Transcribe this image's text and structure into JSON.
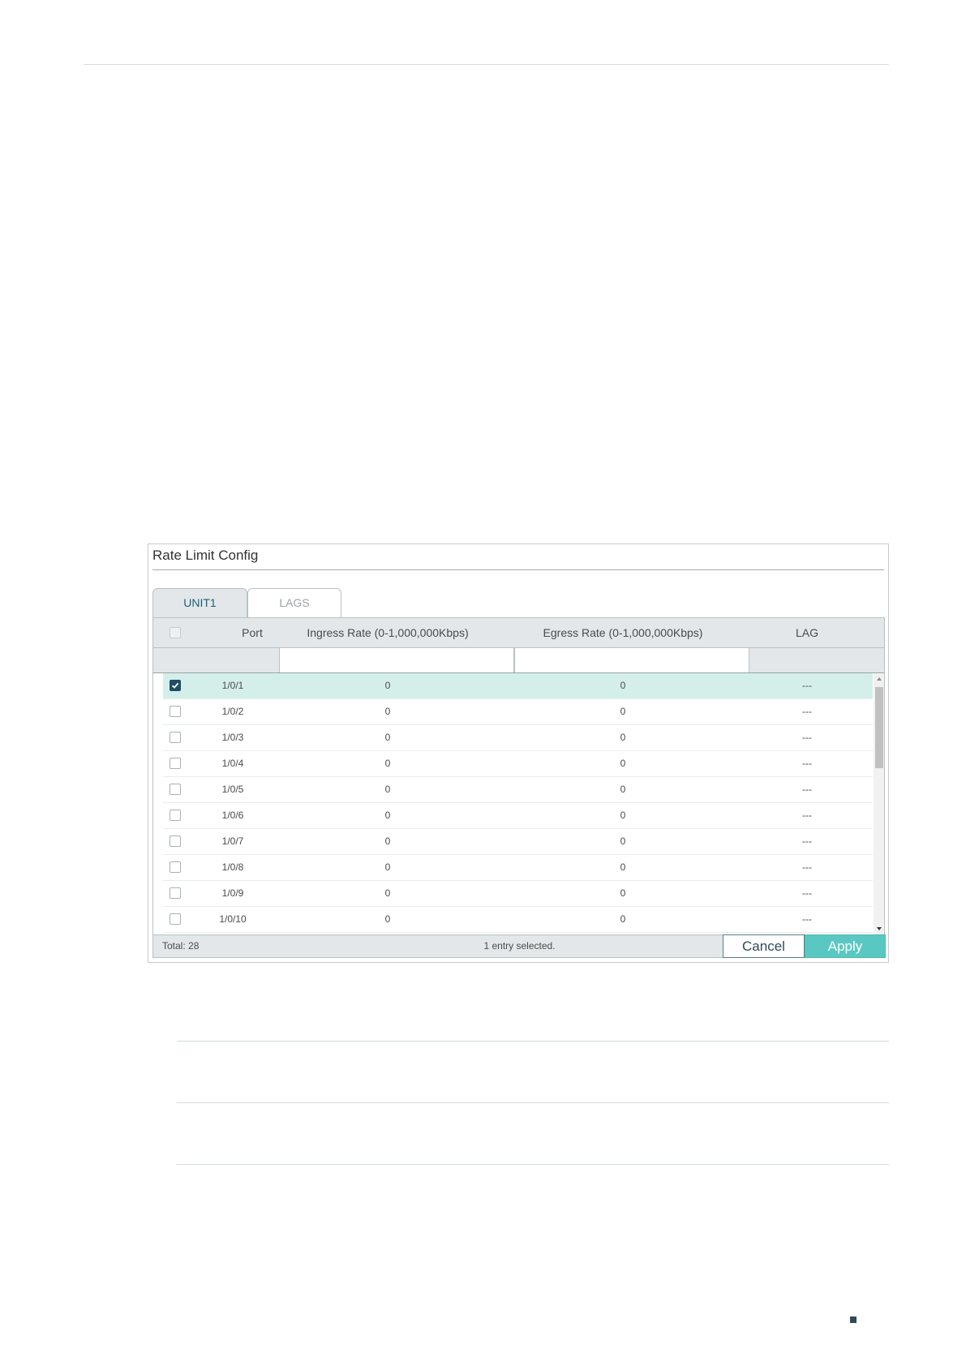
{
  "panel": {
    "title": "Rate Limit Config",
    "tabs": [
      {
        "label": "UNIT1",
        "active": true
      },
      {
        "label": "LAGS",
        "active": false
      }
    ],
    "columns": {
      "port": "Port",
      "ingress": "Ingress Rate (0-1,000,000Kbps)",
      "egress": "Egress Rate (0-1,000,000Kbps)",
      "lag": "LAG"
    },
    "filters": {
      "ingress_value": "",
      "egress_value": ""
    },
    "rows": [
      {
        "port": "1/0/1",
        "ingress": "0",
        "egress": "0",
        "lag": "---",
        "checked": true
      },
      {
        "port": "1/0/2",
        "ingress": "0",
        "egress": "0",
        "lag": "---",
        "checked": false
      },
      {
        "port": "1/0/3",
        "ingress": "0",
        "egress": "0",
        "lag": "---",
        "checked": false
      },
      {
        "port": "1/0/4",
        "ingress": "0",
        "egress": "0",
        "lag": "---",
        "checked": false
      },
      {
        "port": "1/0/5",
        "ingress": "0",
        "egress": "0",
        "lag": "---",
        "checked": false
      },
      {
        "port": "1/0/6",
        "ingress": "0",
        "egress": "0",
        "lag": "---",
        "checked": false
      },
      {
        "port": "1/0/7",
        "ingress": "0",
        "egress": "0",
        "lag": "---",
        "checked": false
      },
      {
        "port": "1/0/8",
        "ingress": "0",
        "egress": "0",
        "lag": "---",
        "checked": false
      },
      {
        "port": "1/0/9",
        "ingress": "0",
        "egress": "0",
        "lag": "---",
        "checked": false
      },
      {
        "port": "1/0/10",
        "ingress": "0",
        "egress": "0",
        "lag": "---",
        "checked": false
      }
    ],
    "footer": {
      "total": "Total: 28",
      "selected_info": "1 entry selected.",
      "cancel_label": "Cancel",
      "apply_label": "Apply"
    }
  },
  "colors": {
    "accent": "#5ac8c2",
    "selected_row": "#d4efea",
    "checkbox_checked": "#1f4e64",
    "header_bg": "#e3e7e9"
  }
}
